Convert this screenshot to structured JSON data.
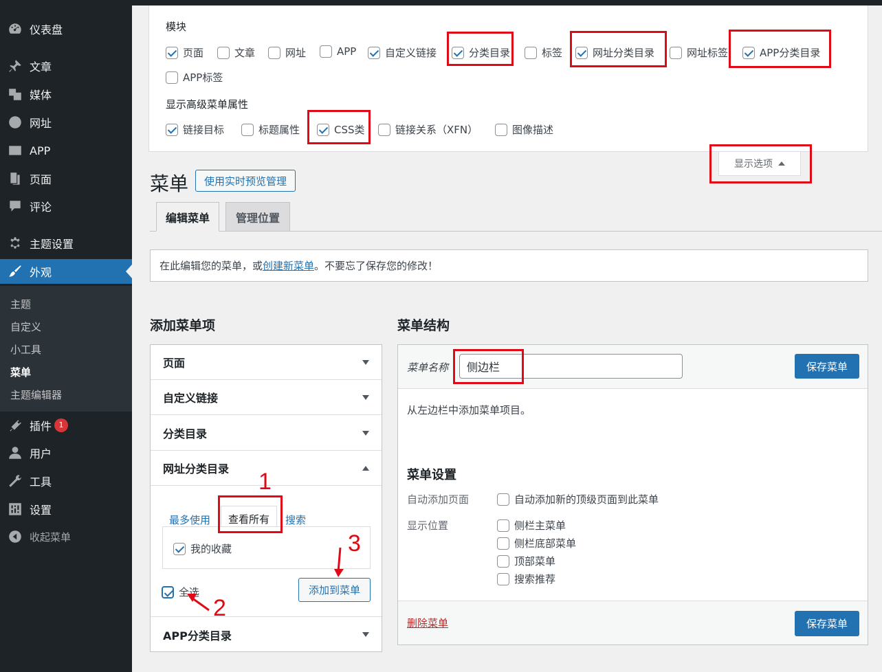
{
  "sidebar": {
    "items": [
      {
        "label": "仪表盘",
        "icon": "dashboard-icon"
      },
      {
        "label": "文章",
        "icon": "pin-icon"
      },
      {
        "label": "媒体",
        "icon": "media-icon"
      },
      {
        "label": "网址",
        "icon": "globe-icon"
      },
      {
        "label": "APP",
        "icon": "app-icon"
      },
      {
        "label": "页面",
        "icon": "page-icon"
      },
      {
        "label": "评论",
        "icon": "comment-icon"
      },
      {
        "label": "主题设置",
        "icon": "gear-icon"
      },
      {
        "label": "外观",
        "icon": "brush-icon"
      },
      {
        "label": "插件",
        "icon": "plugin-icon",
        "badge": "1"
      },
      {
        "label": "用户",
        "icon": "user-icon"
      },
      {
        "label": "工具",
        "icon": "wrench-icon"
      },
      {
        "label": "设置",
        "icon": "settings-icon"
      },
      {
        "label": "收起菜单",
        "icon": "collapse-icon"
      }
    ],
    "submenu": [
      "主题",
      "自定义",
      "小工具",
      "菜单",
      "主题编辑器"
    ]
  },
  "screen_options": {
    "modules_title": "模块",
    "modules": [
      {
        "label": "页面",
        "checked": true
      },
      {
        "label": "文章",
        "checked": false
      },
      {
        "label": "网址",
        "checked": false
      },
      {
        "label": "APP",
        "checked": false
      },
      {
        "label": "自定义链接",
        "checked": true
      },
      {
        "label": "分类目录",
        "checked": true
      },
      {
        "label": "标签",
        "checked": false
      },
      {
        "label": "网址分类目录",
        "checked": true
      },
      {
        "label": "网址标签",
        "checked": false
      },
      {
        "label": "APP分类目录",
        "checked": true
      },
      {
        "label": "APP标签",
        "checked": false
      }
    ],
    "advanced_title": "显示高级菜单属性",
    "advanced": [
      {
        "label": "链接目标",
        "checked": true
      },
      {
        "label": "标题属性",
        "checked": false
      },
      {
        "label": "CSS类",
        "checked": true
      },
      {
        "label": "链接关系（XFN）",
        "checked": false
      },
      {
        "label": "图像描述",
        "checked": false
      }
    ],
    "toggle_label": "显示选项"
  },
  "header": {
    "title": "菜单",
    "live_preview_label": "使用实时预览管理"
  },
  "tabs": [
    {
      "label": "编辑菜单",
      "active": true
    },
    {
      "label": "管理位置",
      "active": false
    }
  ],
  "notice": {
    "prefix": "在此编辑您的菜单，或",
    "link": "创建新菜单",
    "suffix": "。不要忘了保存您的修改！"
  },
  "add_items": {
    "title": "添加菜单项",
    "sections": [
      "页面",
      "自定义链接",
      "分类目录",
      "网址分类目录",
      "APP分类目录"
    ],
    "subtabs": [
      "最多使用",
      "查看所有",
      "搜索"
    ],
    "item_label": "我的收藏",
    "select_all_label": "全选",
    "add_button_label": "添加到菜单"
  },
  "structure": {
    "title": "菜单结构",
    "name_label": "菜单名称",
    "name_value": "侧边栏",
    "save_label": "保存菜单",
    "empty_text": "从左边栏中添加菜单项目。",
    "settings_title": "菜单设置",
    "auto_add_label": "自动添加页面",
    "auto_add_option": "自动添加新的顶级页面到此菜单",
    "location_label": "显示位置",
    "locations": [
      "侧栏主菜单",
      "侧栏底部菜单",
      "顶部菜单",
      "搜索推荐"
    ],
    "delete_label": "删除菜单"
  },
  "annotations": [
    "1",
    "2",
    "3"
  ],
  "colors": {
    "accent": "#2271b1",
    "sidebar": "#1d2327",
    "annotation": "#e00a17"
  }
}
